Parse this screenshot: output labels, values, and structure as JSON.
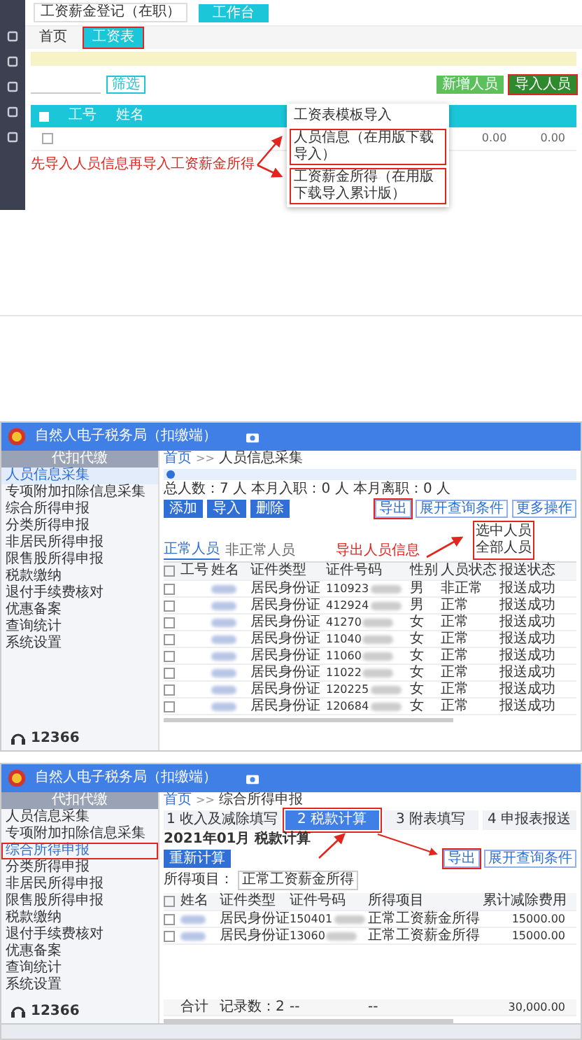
{
  "top": {
    "title": "工资薪金登记（在职）",
    "workbench_button": "工作台",
    "tabs": [
      {
        "label": "首页",
        "selected": false
      },
      {
        "label": "工资表",
        "selected": true
      }
    ],
    "filter_button": "筛选",
    "buttons": [
      {
        "label": "新增人员",
        "highlighted": false
      },
      {
        "label": "导入人员",
        "highlighted": true
      }
    ],
    "import_menu": [
      {
        "label": "工资表模板导入",
        "highlighted": false
      },
      {
        "label": "人员信息（在用版下载导入）",
        "highlighted": true
      },
      {
        "label": "工资薪金所得（在用版下载导入累计版）",
        "highlighted": true
      }
    ],
    "select_all_checked": false,
    "columns": [
      "工号",
      "姓名"
    ],
    "row": {
      "checked": false,
      "values": [
        "0.00",
        "0.00"
      ]
    },
    "annotation": "先导入人员信息再导入工资薪金所得"
  },
  "middle": {
    "app_title": "自然人电子税务局（扣缴端）",
    "sidebar_heading": "代扣代缴",
    "sidebar": [
      {
        "label": "人员信息采集",
        "selected": true
      },
      {
        "label": "专项附加扣除信息采集",
        "selected": false
      },
      {
        "label": "综合所得申报",
        "selected": false
      },
      {
        "label": "分类所得申报",
        "selected": false
      },
      {
        "label": "非居民所得申报",
        "selected": false
      },
      {
        "label": "限售股所得申报",
        "selected": false
      },
      {
        "label": "税款缴纳",
        "selected": false
      },
      {
        "label": "退付手续费核对",
        "selected": false
      },
      {
        "label": "优惠备案",
        "selected": false
      },
      {
        "label": "查询统计",
        "selected": false
      },
      {
        "label": "系统设置",
        "selected": false
      }
    ],
    "breadcrumb": [
      "首页",
      "人员信息采集"
    ],
    "breadcrumb_separator": ">>",
    "counts": "总人数：7 人  本月入职：0 人  本月离职：0 人",
    "buttons": [
      "添加",
      "导入",
      "删除"
    ],
    "right_buttons": [
      {
        "label": "导出",
        "highlighted": true
      },
      {
        "label": "展开查询条件",
        "highlighted": false
      },
      {
        "label": "更多操作",
        "highlighted": false
      }
    ],
    "export_menu": [
      "选中人员",
      "全部人员"
    ],
    "list_tabs": [
      {
        "label": "正常人员",
        "selected": true
      },
      {
        "label": "非正常人员",
        "selected": false
      }
    ],
    "select_all_checked": false,
    "columns": [
      "工号",
      "姓名",
      "证件类型",
      "证件号码",
      "性别",
      "人员状态",
      "报送状态"
    ],
    "rows": [
      {
        "checked": false,
        "id_type": "居民身份证",
        "id_prefix": "110923",
        "sex": "男",
        "status": "非正常",
        "report": "报送成功"
      },
      {
        "checked": false,
        "id_type": "居民身份证",
        "id_prefix": "412924",
        "sex": "男",
        "status": "正常",
        "report": "报送成功"
      },
      {
        "checked": false,
        "id_type": "居民身份证",
        "id_prefix": "41270",
        "sex": "女",
        "status": "正常",
        "report": "报送成功"
      },
      {
        "checked": false,
        "id_type": "居民身份证",
        "id_prefix": "11040",
        "sex": "女",
        "status": "正常",
        "report": "报送成功"
      },
      {
        "checked": false,
        "id_type": "居民身份证",
        "id_prefix": "11060",
        "sex": "女",
        "status": "正常",
        "report": "报送成功"
      },
      {
        "checked": false,
        "id_type": "居民身份证",
        "id_prefix": "11022",
        "sex": "女",
        "status": "正常",
        "report": "报送成功"
      },
      {
        "checked": false,
        "id_type": "居民身份证",
        "id_prefix": "120225",
        "sex": "女",
        "status": "正常",
        "report": "报送成功"
      },
      {
        "checked": false,
        "id_type": "居民身份证",
        "id_prefix": "120684",
        "sex": "女",
        "status": "正常",
        "report": "报送成功"
      }
    ],
    "annotation": "导出人员信息",
    "hotline": "12366"
  },
  "bottom": {
    "app_title": "自然人电子税务局（扣缴端）",
    "sidebar_heading": "代扣代缴",
    "sidebar": [
      {
        "label": "人员信息采集",
        "selected": false
      },
      {
        "label": "专项附加扣除信息采集",
        "selected": false
      },
      {
        "label": "综合所得申报",
        "selected": true
      },
      {
        "label": "分类所得申报",
        "selected": false
      },
      {
        "label": "非居民所得申报",
        "selected": false
      },
      {
        "label": "限售股所得申报",
        "selected": false
      },
      {
        "label": "税款缴纳",
        "selected": false
      },
      {
        "label": "退付手续费核对",
        "selected": false
      },
      {
        "label": "优惠备案",
        "selected": false
      },
      {
        "label": "查询统计",
        "selected": false
      },
      {
        "label": "系统设置",
        "selected": false
      }
    ],
    "breadcrumb": [
      "首页",
      "综合所得申报"
    ],
    "breadcrumb_separator": ">>",
    "steps": [
      {
        "label": "1 收入及减除填写",
        "selected": false
      },
      {
        "label": "2 税款计算",
        "selected": true
      },
      {
        "label": "3 附表填写",
        "selected": false
      },
      {
        "label": "4 申报表报送",
        "selected": false
      }
    ],
    "period": "2021年01月 税款计算",
    "calc_button": "重新计算",
    "right_buttons": [
      {
        "label": "导出",
        "highlighted": true
      },
      {
        "label": "展开查询条件",
        "highlighted": false
      }
    ],
    "filter_label": "所得项目：",
    "filter_value": "正常工资薪金所得",
    "select_all_checked": false,
    "columns": [
      "姓名",
      "证件类型",
      "证件号码",
      "所得项目",
      "累计减除费用"
    ],
    "rows": [
      {
        "checked": false,
        "id_type": "居民身份证",
        "id_prefix": "150401",
        "item": "正常工资薪金所得",
        "deduction": "15000.00"
      },
      {
        "checked": false,
        "id_type": "居民身份证",
        "id_prefix": "13060",
        "item": "正常工资薪金所得",
        "deduction": "15000.00"
      }
    ],
    "total": {
      "label": "合计",
      "records": "记录数：2",
      "dash_1": "--",
      "dash_2": "--",
      "deduction": "30,000.00"
    },
    "hotline": "12366"
  }
}
